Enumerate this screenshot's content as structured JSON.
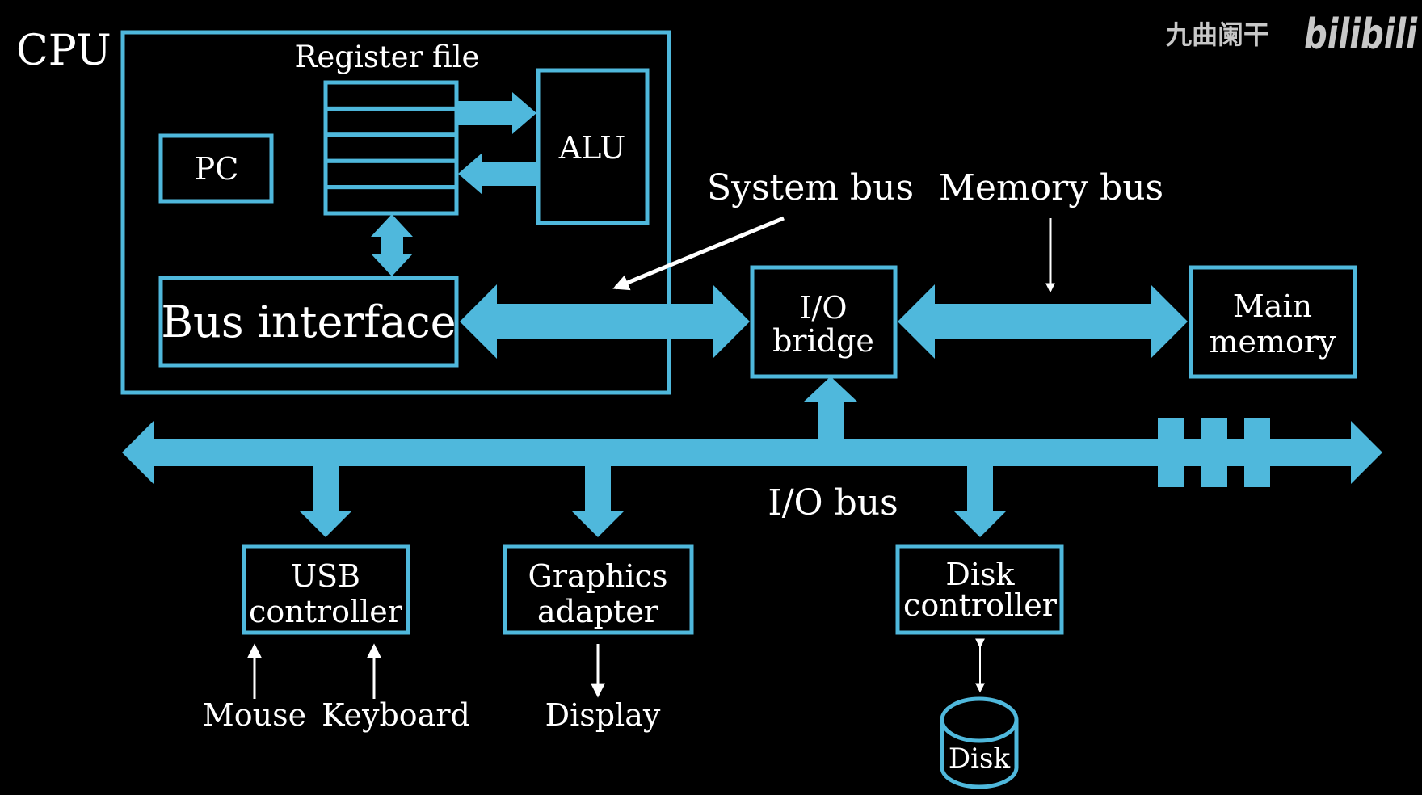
{
  "watermark": {
    "author": "九曲阑干",
    "brand": "bilibili"
  },
  "colors": {
    "background": "#000000",
    "bus": "#4fb8dc",
    "text": "#ffffff",
    "annotation_arrow": "#ffffff"
  },
  "cpu": {
    "label": "CPU",
    "register_file_label": "Register file",
    "register_count": 5,
    "pc_label": "PC",
    "alu_label": "ALU",
    "bus_interface_label": "Bus interface"
  },
  "buses": {
    "system_bus_label": "System bus",
    "memory_bus_label": "Memory bus",
    "io_bus_label": "I/O bus"
  },
  "io_bridge": {
    "line1": "I/O",
    "line2": "bridge"
  },
  "main_memory": {
    "line1": "Main",
    "line2": "memory"
  },
  "devices": {
    "usb": {
      "line1": "USB",
      "line2": "controller"
    },
    "graphics": {
      "line1": "Graphics",
      "line2": "adapter"
    },
    "disk_controller": {
      "line1": "Disk",
      "line2": "controller"
    },
    "disk_label": "Disk",
    "mouse_label": "Mouse",
    "keyboard_label": "Keyboard",
    "display_label": "Display"
  }
}
